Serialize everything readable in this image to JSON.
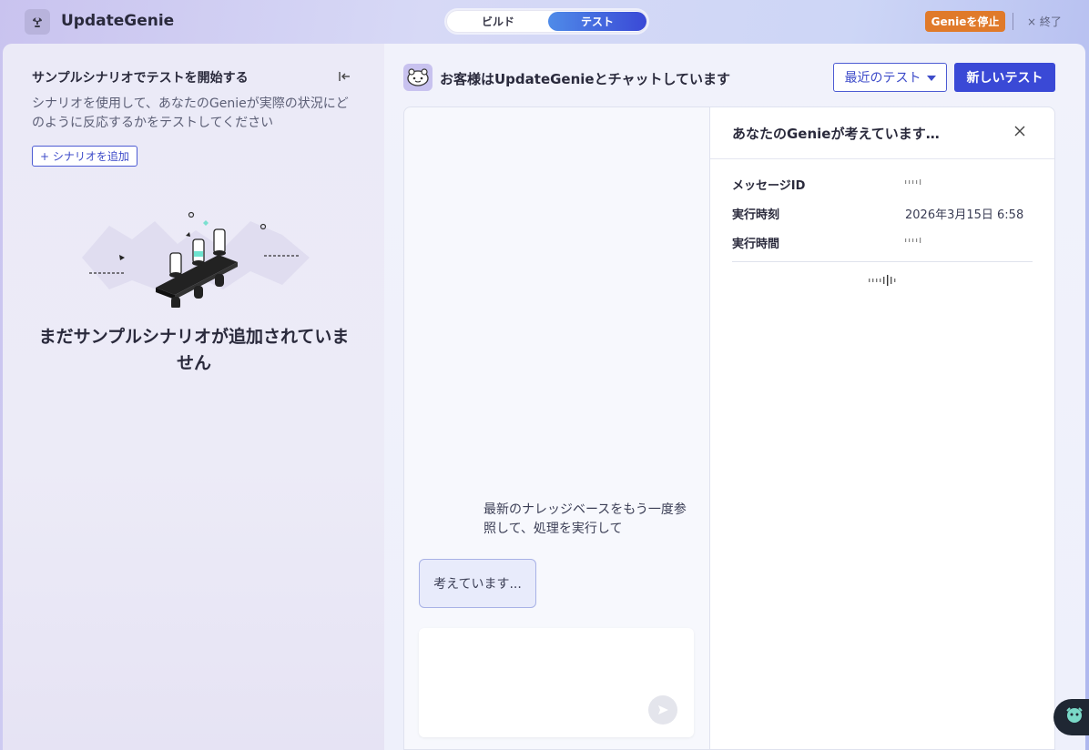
{
  "app": {
    "name": "UpdateGenie"
  },
  "mode_toggle": {
    "build_label": "ビルド",
    "test_label": "テスト",
    "active": "test"
  },
  "top_actions": {
    "stop_label": "Genieを停止",
    "exit_label": "× 終了"
  },
  "left_panel": {
    "title": "サンプルシナリオでテストを開始する",
    "description": "シナリオを使用して、あなたのGenieが実際の状況にどのように反応するかをテストしてください",
    "add_scenario_label": "+ シナリオを追加",
    "empty_message": "まだサンプルシナリオが追加されていません"
  },
  "chat": {
    "header": "お客様はUpdateGenieとチャットしています",
    "recent_tests_label": "最近のテスト",
    "new_test_label": "新しいテスト",
    "message": "最新のナレッジベースをもう一度参照して、処理を実行して",
    "thinking_bubble": "考えています...",
    "input_placeholder": ""
  },
  "thought_panel": {
    "title": "あなたのGenieが考えています…",
    "rows": [
      {
        "label": "メッセージID",
        "value": ""
      },
      {
        "label": "実行時刻",
        "value": "2026年3月15日 6:58"
      },
      {
        "label": "実行時間",
        "value": ""
      }
    ]
  },
  "colors": {
    "accent": "#3a49d6",
    "stop_button": "#e07a2a",
    "outline": "#4c5bd3"
  },
  "icons": {
    "app_logo": "genie-lamp-icon",
    "collapse": "collapse-left-icon",
    "dropdown": "chevron-down-icon",
    "close": "close-icon",
    "send": "send-icon",
    "assistant": "assistant-bubble-icon"
  }
}
